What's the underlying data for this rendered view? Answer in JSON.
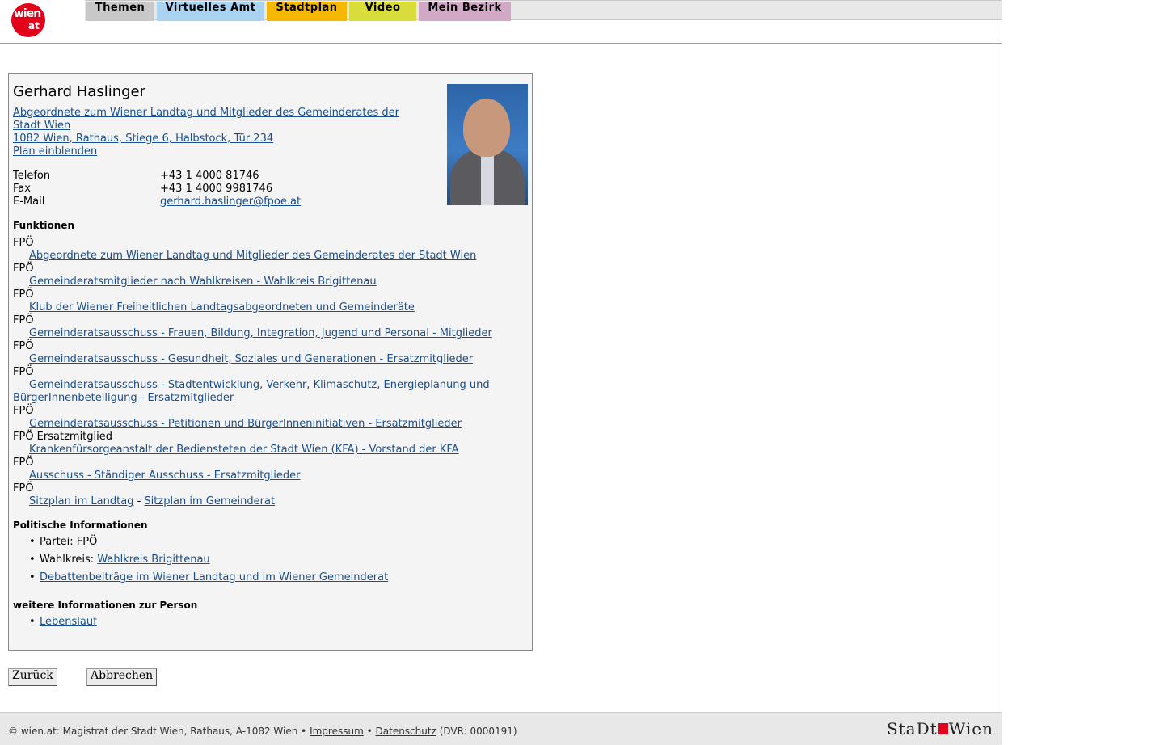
{
  "logo": {
    "line1": "wien",
    "line2": "at"
  },
  "nav": [
    {
      "label": "Themen",
      "color": "#c8c8c8"
    },
    {
      "label": "Virtuelles Amt",
      "color": "#a9d3f0"
    },
    {
      "label": "Stadtplan",
      "color": "#f5b800"
    },
    {
      "label": "Video",
      "color": "#d9dd3a"
    },
    {
      "label": "Mein Bezirk",
      "color": "#d1a8c6"
    }
  ],
  "person": {
    "name": "Gerhard Haslinger",
    "role_line1": "Abgeordnete zum Wiener Landtag und Mitglieder des Gemeinderates der",
    "role_line2": "Stadt Wien",
    "address": "1082 Wien, Rathaus, Stiege 6, Halbstock, Tür 234",
    "plan_link": "Plan einblenden"
  },
  "contact": [
    {
      "label": "Telefon",
      "value": "+43 1 4000 81746"
    },
    {
      "label": "Fax",
      "value": "+43 1 4000 9981746"
    },
    {
      "label": "E-Mail",
      "value": "gerhard.haslinger@fpoe.at"
    }
  ],
  "functions": {
    "heading": "Funktionen",
    "items": [
      {
        "party": "FPÖ",
        "link": "Abgeordnete zum Wiener Landtag und Mitglieder des Gemeinderates der Stadt Wien"
      },
      {
        "party": "FPÖ",
        "link": "Gemeinderatsmitglieder nach Wahlkreisen - Wahlkreis Brigittenau"
      },
      {
        "party": "FPÖ",
        "link": "Klub der Wiener Freiheitlichen Landtagsabgeordneten und Gemeinderäte"
      },
      {
        "party": "FPÖ",
        "link": "Gemeinderatsausschuss - Frauen, Bildung, Integration, Jugend und Personal - Mitglieder"
      },
      {
        "party": "FPÖ",
        "link": "Gemeinderatsausschuss - Gesundheit, Soziales und Generationen - Ersatzmitglieder"
      },
      {
        "party": "FPÖ",
        "link_line1": "Gemeinderatsausschuss - Stadtentwicklung, Verkehr, Klimaschutz, Energieplanung und",
        "link_line2": "BürgerInnenbeteiligung - Ersatzmitglieder"
      },
      {
        "party": "FPÖ",
        "link": "Gemeinderatsausschuss - Petitionen und BürgerInneninitiativen - Ersatzmitglieder"
      },
      {
        "party": "FPÖ Ersatzmitglied",
        "link": "Krankenfürsorgeanstalt der Bediensteten der Stadt Wien (KFA) - Vorstand der KFA"
      },
      {
        "party": "FPÖ",
        "link": "Ausschuss - Ständiger Ausschuss - Ersatzmitglieder"
      }
    ],
    "last_party": "FPÖ",
    "sitz_landtag": "Sitzplan im Landtag",
    "sitz_separator": "-",
    "sitz_gemeinderat": "Sitzplan im Gemeinderat"
  },
  "political": {
    "heading": "Politische Informationen",
    "partei": "Partei: FPÖ",
    "wahlkreis_label": "Wahlkreis:",
    "wahlkreis_link": "Wahlkreis Brigittenau",
    "debatten": "Debattenbeiträge im Wiener Landtag und im Wiener Gemeinderat"
  },
  "further": {
    "heading": "weitere Informationen zur Person",
    "lebenslauf": "Lebenslauf"
  },
  "buttons": {
    "back": "Zurück",
    "cancel": "Abbrechen"
  },
  "footer": {
    "text": "© wien.at: Magistrat der Stadt Wien, Rathaus, A-1082 Wien •",
    "impressum": "Impressum",
    "sep": "•",
    "datenschutz": "Datenschutz",
    "dvr": "(DVR: 0000191)",
    "logo_left": "StaDt",
    "logo_right": "Wien"
  }
}
